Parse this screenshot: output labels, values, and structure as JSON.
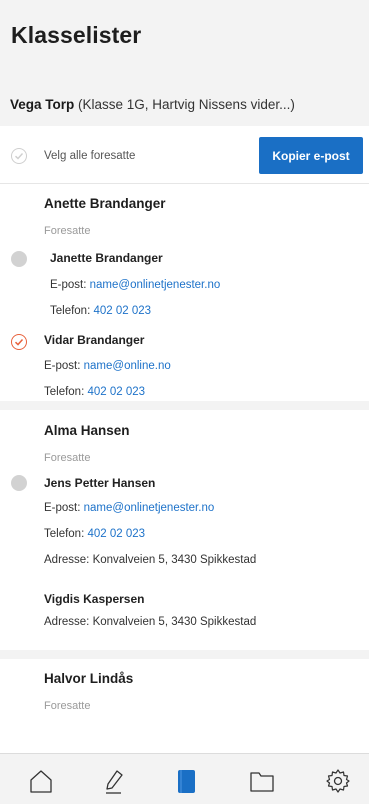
{
  "header": {
    "title": "Klasselister"
  },
  "student_bar": {
    "name": "Vega Torp",
    "meta": " (Klasse 1G, Hartvig Nissens vider...)"
  },
  "select_all": {
    "label": "Velg alle foresatte",
    "copy_button": "Kopier e-post"
  },
  "labels": {
    "foresatte": "Foresatte",
    "email": "E-post: ",
    "phone": "Telefon: "
  },
  "students": [
    {
      "name": "Anette Brandanger",
      "guardians": [
        {
          "name": "Janette Brandanger",
          "email": "name@onlinetjenester.no",
          "phone": "402 02 023",
          "selected": false
        },
        {
          "name": "Vidar Brandanger",
          "email": "name@online.no",
          "phone": "402 02 023",
          "selected": true
        }
      ]
    },
    {
      "name": "Alma Hansen",
      "guardians": [
        {
          "name": "Jens Petter Hansen",
          "email": "name@onlinetjenester.no",
          "phone": "402 02 023",
          "address": "Adresse: Konvalveien 5, 3430 Spikkestad",
          "selected": false
        },
        {
          "name": "Vigdis Kaspersen",
          "address": "Adresse: Konvalveien 5, 3430 Spikkestad"
        }
      ]
    },
    {
      "name": "Halvor Lindås"
    }
  ],
  "nav": [
    {
      "icon": "home-icon",
      "active": false
    },
    {
      "icon": "pen-icon",
      "active": false
    },
    {
      "icon": "book-icon",
      "active": true
    },
    {
      "icon": "folder-icon",
      "active": false
    },
    {
      "icon": "gear-icon",
      "active": false
    }
  ],
  "colors": {
    "accent": "#1a6fc5",
    "link": "#1d72c9",
    "selected": "#e8613c"
  }
}
